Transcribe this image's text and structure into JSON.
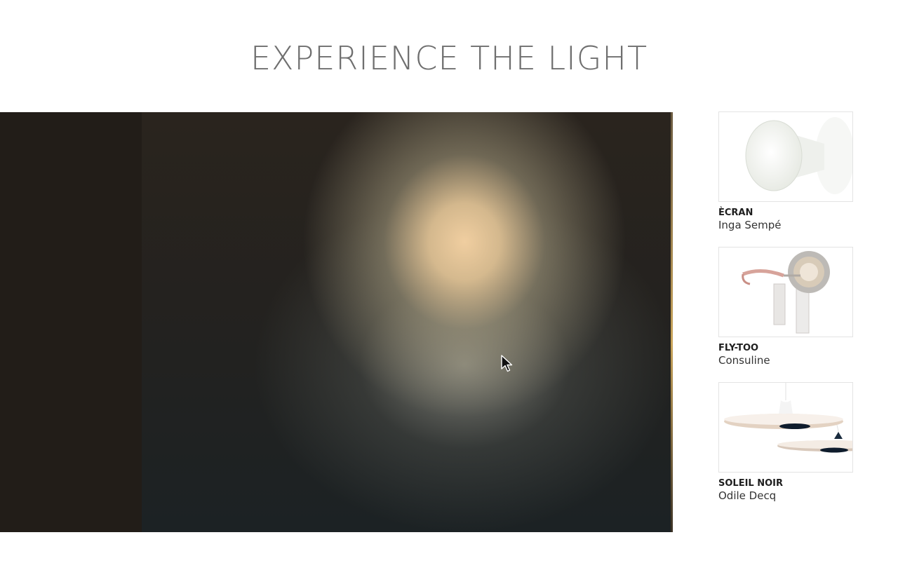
{
  "headline": "EXPERIENCE THE LIGHT",
  "products": [
    {
      "name": "ÈCRAN",
      "designer": "Inga Sempé",
      "image_icon": "ecran-lamp-icon"
    },
    {
      "name": "FLY-TOO",
      "designer": "Consuline",
      "image_icon": "fly-too-lamp-icon"
    },
    {
      "name": "SOLEIL NOIR",
      "designer": "Odile Decq",
      "image_icon": "soleil-noir-lamp-icon"
    }
  ],
  "colors": {
    "headline": "#6f6f6f",
    "hero_dark": "#231e19",
    "light_warm": "#f0cea0",
    "thumb_border": "#e3e3e3"
  },
  "cursor_icon": "arrow-pointer-icon"
}
